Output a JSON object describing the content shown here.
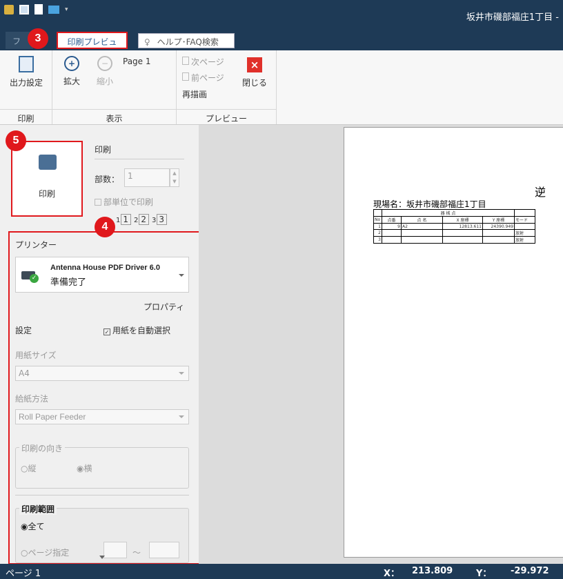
{
  "window": {
    "title": "坂井市磯部福庄1丁目 -"
  },
  "tabs": {
    "file": "フ",
    "print_preview": "印刷プレビュー",
    "help_search": "ヘルプ･FAQ検索"
  },
  "ribbon": {
    "output_settings": "出力設定",
    "zoom_in": "拡大",
    "zoom_out": "縮小",
    "page_label": "Page 1",
    "next_page": "次ページ",
    "prev_page": "前ページ",
    "redraw": "再描画",
    "close": "閉じる",
    "group_print": "印刷",
    "group_view": "表示",
    "group_preview": "プレビュー"
  },
  "print_panel": {
    "print_button": "印刷",
    "header": "印刷",
    "copies_label": "部数：",
    "copies_value": "1",
    "collate_label": "部単位で印刷",
    "collate_pages": [
      "1",
      "1",
      "2",
      "2",
      "3",
      "3"
    ]
  },
  "printer": {
    "section_label": "プリンター",
    "name": "Antenna House PDF Driver 6.0",
    "status": "準備完了",
    "properties": "プロパティ"
  },
  "settings": {
    "label": "設定",
    "auto_paper": "用紙を自動選択",
    "paper_size_label": "用紙サイズ",
    "paper_size_value": "A4",
    "feed_label": "給紙方法",
    "feed_value": "Roll Paper Feeder",
    "orientation_label": "印刷の向き",
    "portrait": "縦",
    "landscape": "横",
    "range_label": "印刷範囲",
    "all": "全て",
    "page_spec": "ページ指定",
    "tilde": "～"
  },
  "badges": {
    "b3": "3",
    "b4": "4",
    "b5": "5"
  },
  "preview": {
    "title_partial": "逆 ",
    "site_name": "現場名：坂井市磯部福庄1丁目",
    "header_group": "器 械 点",
    "columns": [
      "No",
      "点番",
      "点 名",
      "X 座標",
      "Y 座標",
      "モード"
    ],
    "rows": [
      {
        "no": "1",
        "pt": "9",
        "name": "A2",
        "x": "12813.611",
        "y": "24390.949",
        "mode": ""
      },
      {
        "no": "2",
        "pt": "",
        "name": "",
        "x": "",
        "y": "",
        "mode": "放射"
      },
      {
        "no": "3",
        "pt": "",
        "name": "",
        "x": "",
        "y": "",
        "mode": "放射"
      }
    ]
  },
  "status": {
    "page": "ページ 1",
    "x_label": "X：",
    "x_value": "213.809",
    "y_label": "Y：",
    "y_value": "-29.972"
  },
  "colors": {
    "accent_red": "#e0181c",
    "titlebar": "#1e3a56",
    "link_blue": "#2a5a8f"
  }
}
